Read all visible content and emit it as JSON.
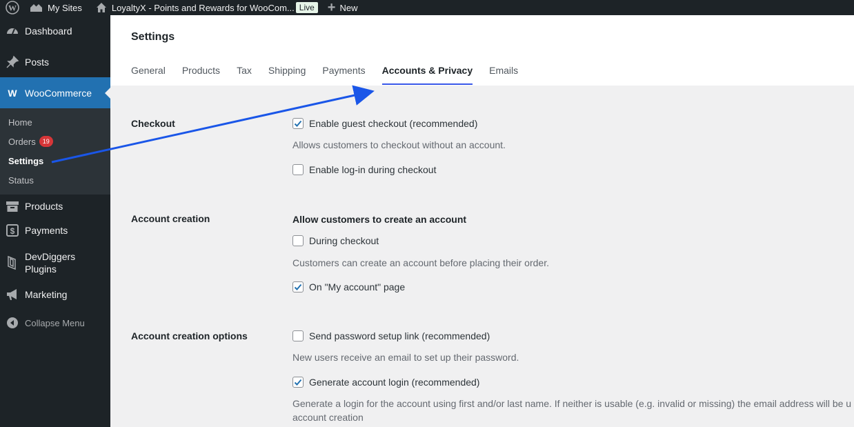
{
  "adminbar": {
    "my_sites": "My Sites",
    "site_name": "LoyaltyX - Points and Rewards for WooCom...",
    "live": "Live",
    "new": "New"
  },
  "sidebar": {
    "dashboard": "Dashboard",
    "posts": "Posts",
    "woocommerce": "WooCommerce",
    "sub": {
      "home": "Home",
      "orders": "Orders",
      "orders_count": "19",
      "settings": "Settings",
      "status": "Status"
    },
    "products": "Products",
    "payments": "Payments",
    "devdiggers_line1": "DevDiggers",
    "devdiggers_line2": "Plugins",
    "marketing": "Marketing",
    "collapse": "Collapse Menu"
  },
  "page": {
    "title": "Settings",
    "tabs": [
      "General",
      "Products",
      "Tax",
      "Shipping",
      "Payments",
      "Accounts & Privacy",
      "Emails"
    ],
    "active_tab": "Accounts & Privacy"
  },
  "settings": {
    "checkout_label": "Checkout",
    "guest_checkout": "Enable guest checkout (recommended)",
    "guest_checkout_checked": true,
    "guest_checkout_help": "Allows customers to checkout without an account.",
    "login_checkout": "Enable log-in during checkout",
    "login_checkout_checked": false,
    "account_creation_label": "Account creation",
    "account_creation_heading": "Allow customers to create an account",
    "during_checkout": "During checkout",
    "during_checkout_checked": false,
    "during_checkout_help": "Customers can create an account before placing their order.",
    "my_account": "On \"My account\" page",
    "my_account_checked": true,
    "options_label": "Account creation options",
    "password_link": "Send password setup link (recommended)",
    "password_link_checked": false,
    "password_link_help": "New users receive an email to set up their password.",
    "generate_login": "Generate account login (recommended)",
    "generate_login_checked": true,
    "generate_login_help_1": "Generate a login for the account using first and/or last name. If neither is usable (e.g. invalid or missing) the email address will be used",
    "generate_login_help_2": "account creation"
  },
  "colors": {
    "admin_dark": "#1d2327",
    "accent": "#2271b1",
    "annotation_arrow": "#1a56e8",
    "tab_underline": "#3858e9"
  }
}
